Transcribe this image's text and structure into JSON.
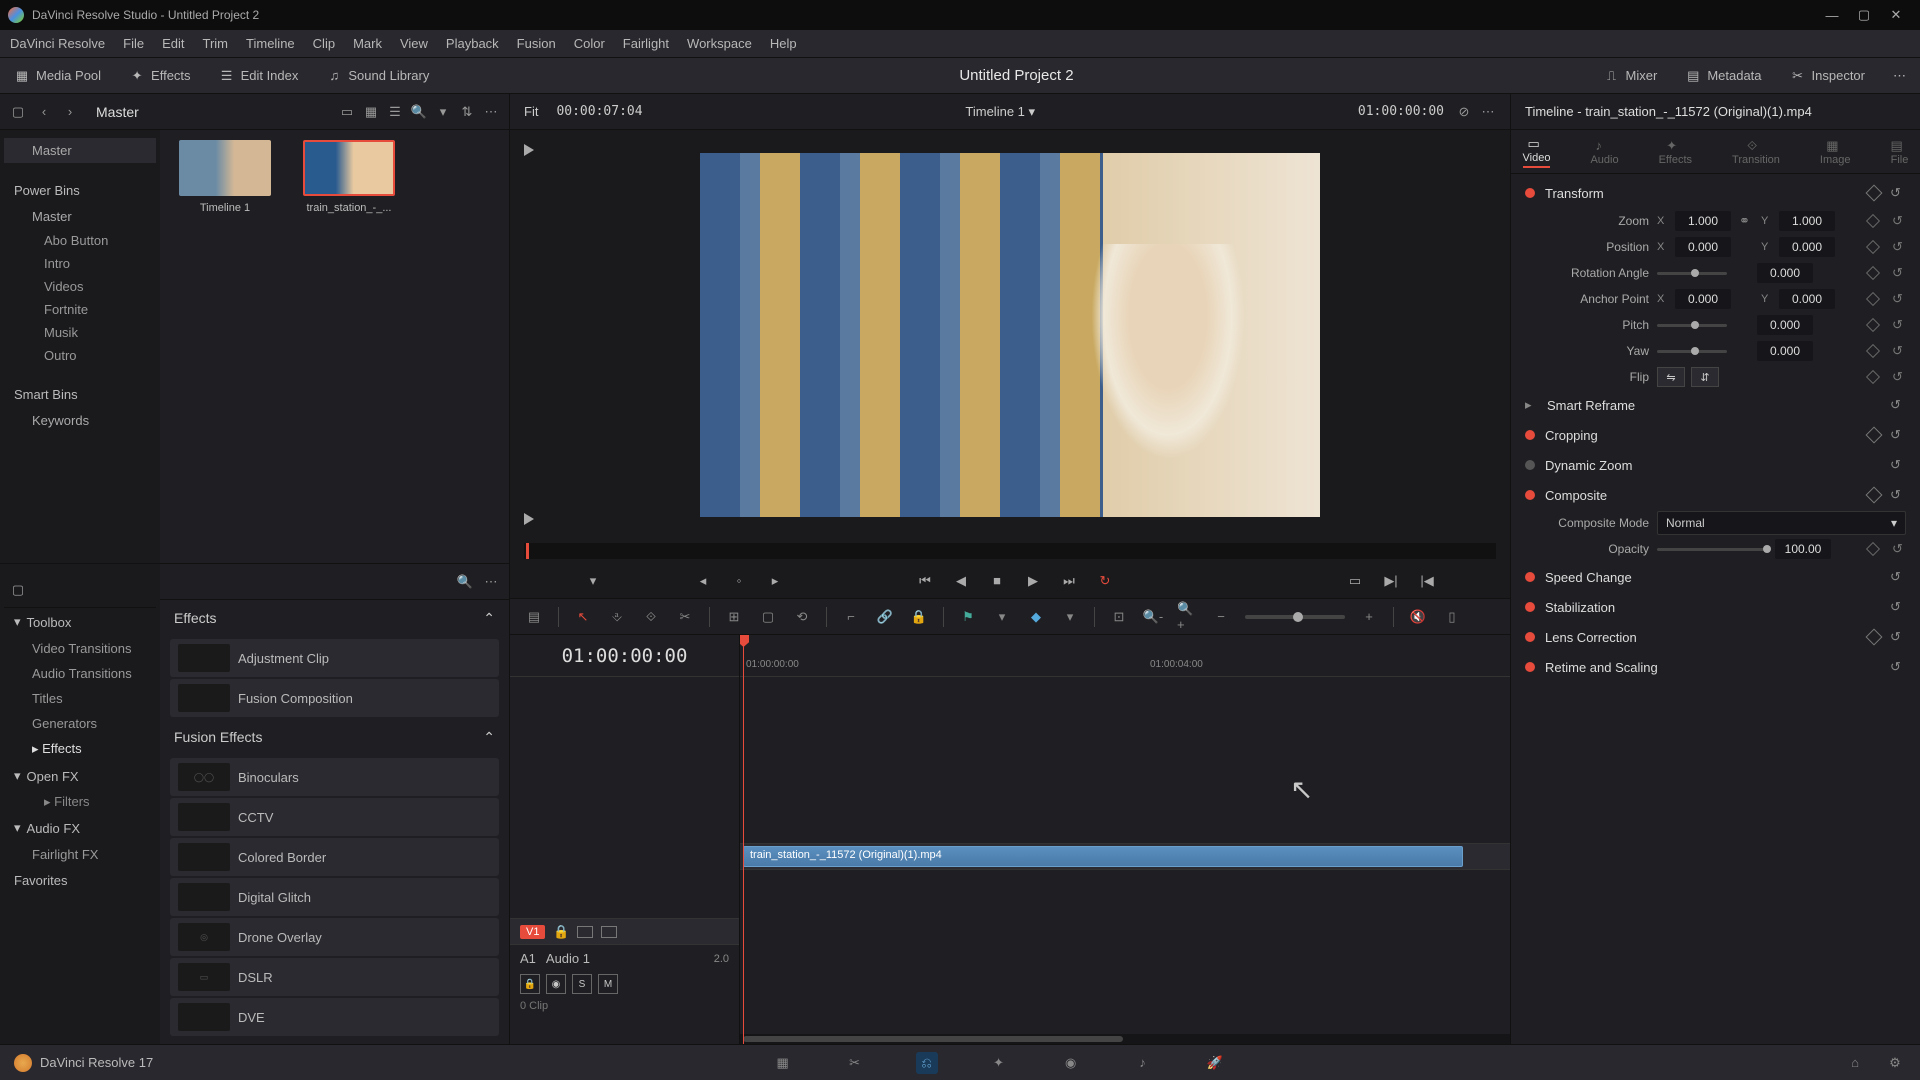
{
  "app": {
    "title": "DaVinci Resolve Studio - Untitled Project 2",
    "project": "Untitled Project 2",
    "version": "DaVinci Resolve 17"
  },
  "menu": [
    "DaVinci Resolve",
    "File",
    "Edit",
    "Trim",
    "Timeline",
    "Clip",
    "Mark",
    "View",
    "Playback",
    "Fusion",
    "Color",
    "Fairlight",
    "Workspace",
    "Help"
  ],
  "toolbar": {
    "media_pool": "Media Pool",
    "effects": "Effects",
    "edit_index": "Edit Index",
    "sound_library": "Sound Library",
    "mixer": "Mixer",
    "metadata": "Metadata",
    "inspector": "Inspector"
  },
  "pool": {
    "master": "Master",
    "view_fit": "Fit",
    "view_tc": "00:00:07:04",
    "timeline_name": "Timeline 1",
    "timeline_tc": "01:00:00:00",
    "power_bins_hdr": "Power Bins",
    "master_item": "Master",
    "bins": [
      "Abo Button",
      "Intro",
      "Videos",
      "Fortnite",
      "Musik",
      "Outro"
    ],
    "smart_bins_hdr": "Smart Bins",
    "keywords": "Keywords",
    "thumbs": [
      {
        "name": "Timeline 1"
      },
      {
        "name": "train_station_-_..."
      }
    ]
  },
  "fx": {
    "toolbox": "Toolbox",
    "toolbox_items": [
      "Video Transitions",
      "Audio Transitions",
      "Titles",
      "Generators"
    ],
    "effects_hdr": "Effects",
    "openfx": "Open FX",
    "filters": "Filters",
    "audiofx": "Audio FX",
    "fairlightfx": "Fairlight FX",
    "favorites": "Favorites",
    "sec_effects": "Effects",
    "sec_fusion": "Fusion Effects",
    "list_effects": [
      "Adjustment Clip",
      "Fusion Composition"
    ],
    "list_fusion": [
      "Binoculars",
      "CCTV",
      "Colored Border",
      "Digital Glitch",
      "Drone Overlay",
      "DSLR",
      "DVE"
    ]
  },
  "timeline": {
    "tc": "01:00:00:00",
    "v1": "V1",
    "a1": "A1",
    "a1_name": "Audio 1",
    "a1_level": "2.0",
    "a1_clips": "0 Clip",
    "clip_name": "train_station_-_11572 (Original)(1).mp4",
    "ruler": [
      "01:00:00:00",
      "01:00:04:00"
    ]
  },
  "inspector": {
    "title": "Timeline - train_station_-_11572 (Original)(1).mp4",
    "tabs": [
      "Video",
      "Audio",
      "Effects",
      "Transition",
      "Image",
      "File"
    ],
    "transform": {
      "hdr": "Transform",
      "zoom": "Zoom",
      "x": "1.000",
      "y": "1.000",
      "pos": "Position",
      "px": "0.000",
      "py": "0.000",
      "rot": "Rotation Angle",
      "rv": "0.000",
      "anchor": "Anchor Point",
      "ax": "0.000",
      "ay": "0.000",
      "pitch": "Pitch",
      "pitchv": "0.000",
      "yaw": "Yaw",
      "yawv": "0.000",
      "flip": "Flip"
    },
    "smart_reframe": "Smart Reframe",
    "cropping": "Cropping",
    "dyn_zoom": "Dynamic Zoom",
    "composite": "Composite",
    "comp_mode_lbl": "Composite Mode",
    "comp_mode": "Normal",
    "opacity_lbl": "Opacity",
    "opacity": "100.00",
    "speed": "Speed Change",
    "stab": "Stabilization",
    "lens": "Lens Correction",
    "retime": "Retime and Scaling"
  }
}
